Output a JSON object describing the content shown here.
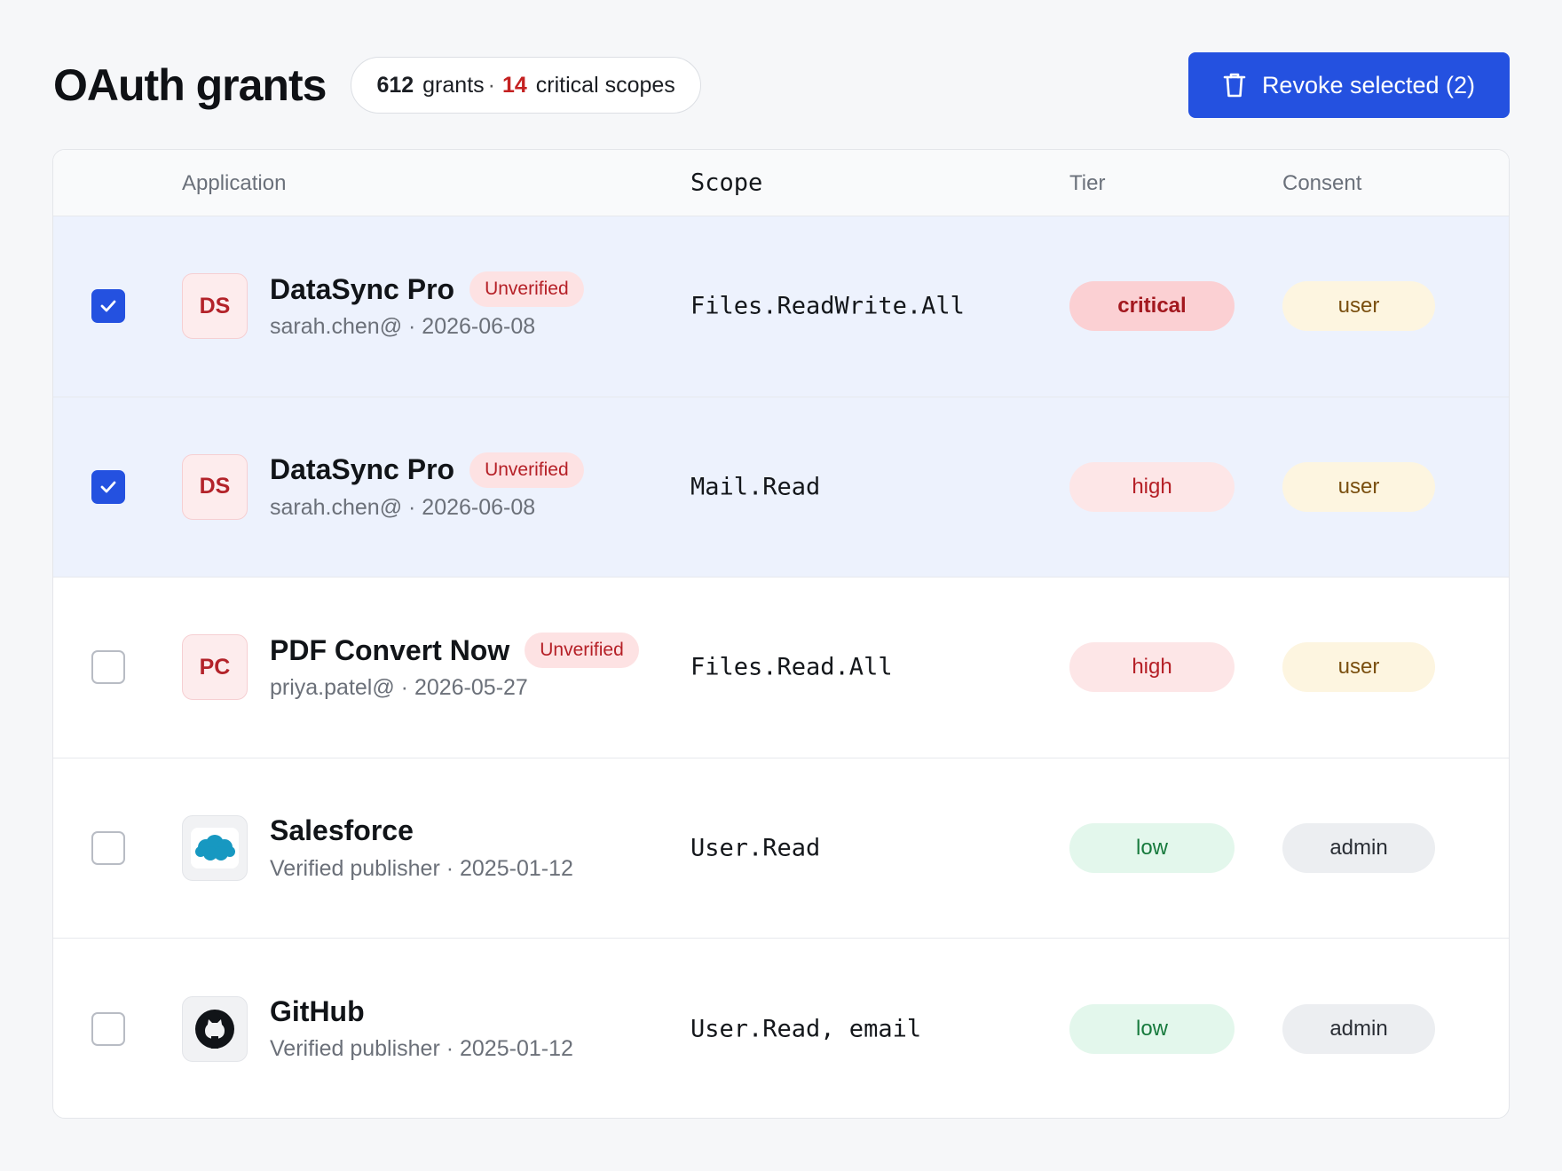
{
  "header": {
    "title": "OAuth grants",
    "summary": {
      "grants_count": "612",
      "grants_label": "grants",
      "separator": "·",
      "critical_count": "14",
      "critical_label": "critical scopes"
    },
    "revoke_button_label": "Revoke selected (2)"
  },
  "table": {
    "columns": [
      "Application",
      "Scope",
      "Tier",
      "Consent"
    ],
    "rows": [
      {
        "selected": true,
        "icon": "DS",
        "name": "DataSync Pro",
        "badge": "Unverified",
        "meta": "sarah.chen@ · 2026-06-08",
        "scope": "Files.ReadWrite.All",
        "tier": "critical",
        "consent": "user"
      },
      {
        "selected": true,
        "icon": "DS",
        "name": "DataSync Pro",
        "badge": "Unverified",
        "meta": "sarah.chen@ · 2026-06-08",
        "scope": "Mail.Read",
        "tier": "high",
        "consent": "user"
      },
      {
        "selected": false,
        "icon": "PC",
        "name": "PDF Convert Now",
        "badge": "Unverified",
        "meta": "priya.patel@ · 2026-05-27",
        "scope": "Files.Read.All",
        "tier": "high",
        "consent": "user"
      },
      {
        "selected": false,
        "icon": "salesforce-cloud-icon",
        "name": "Salesforce",
        "meta": "Verified publisher · 2025-01-12",
        "scope": "User.Read",
        "tier": "low",
        "consent": "admin"
      },
      {
        "selected": false,
        "icon": "github-icon",
        "name": "GitHub",
        "meta": "Verified publisher · 2025-01-12",
        "scope": "User.Read, email",
        "tier": "low",
        "consent": "admin"
      }
    ]
  },
  "colors": {
    "accent": "#2451e0",
    "selected_row": "#edf2fd",
    "critical": "#c42121",
    "salesforce": "#1798c1"
  }
}
